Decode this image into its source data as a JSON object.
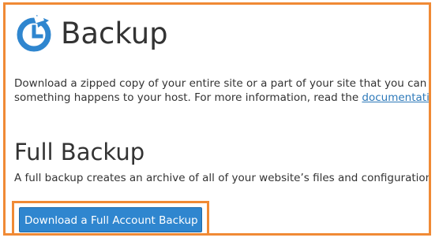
{
  "header": {
    "title": "Backup",
    "logo_icon": "backup-clock-icon",
    "accent_color": "#2f86cf"
  },
  "intro": {
    "line1": "Download a zipped copy of your entire site or a part of your site that you can save",
    "line2_prefix": "something happens to your host. For more information, read the ",
    "link_text": "documentation"
  },
  "full_backup": {
    "title": "Full Backup",
    "description": "A full backup creates an archive of all of your website’s files and configuration. Yo",
    "button_label": "Download a Full Account Backup",
    "button_color": "#2f86cf",
    "highlight_color": "#f08a35"
  }
}
